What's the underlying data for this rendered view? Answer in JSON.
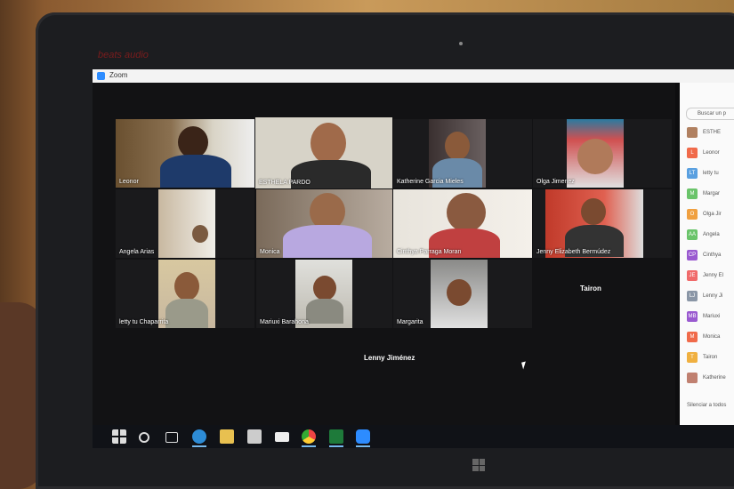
{
  "window": {
    "title": "Zoom",
    "brand": "beats audio"
  },
  "participants_video": [
    {
      "name": "Leonor"
    },
    {
      "name": "ESTHELA PARDO",
      "active": true
    },
    {
      "name": "Katherine Garcia  Mieles"
    },
    {
      "name": "Olga Jimenez"
    },
    {
      "name": "Angela Arias"
    },
    {
      "name": "Monica"
    },
    {
      "name": "Cinthya Parraga Moran"
    },
    {
      "name": "Jenny Elizabeth Bermúdez"
    },
    {
      "name": "letty tu Chaparrita"
    },
    {
      "name": "Mariuxi Barahona"
    },
    {
      "name": "Margarita"
    }
  ],
  "no_video": {
    "tairon": "Tairon",
    "lenny": "Lenny Jiménez"
  },
  "panel": {
    "search_placeholder": "Buscar un p",
    "items": [
      {
        "initials": "",
        "name": "ESTHE",
        "color": "#b08060"
      },
      {
        "initials": "L",
        "name": "Leonor",
        "color": "#f06a4a"
      },
      {
        "initials": "LT",
        "name": "letty tu",
        "color": "#5aa0e0"
      },
      {
        "initials": "M",
        "name": "Margar",
        "color": "#6ac46a"
      },
      {
        "initials": "O",
        "name": "Olga Jir",
        "color": "#f0a040"
      },
      {
        "initials": "AA",
        "name": "Angela",
        "color": "#6ac46a"
      },
      {
        "initials": "CP",
        "name": "Cinthya",
        "color": "#9a5ad0"
      },
      {
        "initials": "JE",
        "name": "Jenny El",
        "color": "#f06a6a"
      },
      {
        "initials": "LJ",
        "name": "Lenny Ji",
        "color": "#8a96a6"
      },
      {
        "initials": "MB",
        "name": "Mariuxi",
        "color": "#9a5ad0"
      },
      {
        "initials": "M",
        "name": "Monica",
        "color": "#f06a4a"
      },
      {
        "initials": "T",
        "name": "Tairon",
        "color": "#f0b040"
      },
      {
        "initials": "",
        "name": "Katherine",
        "color": "#c08070"
      }
    ],
    "mute_all": "Silenciar a todos"
  }
}
